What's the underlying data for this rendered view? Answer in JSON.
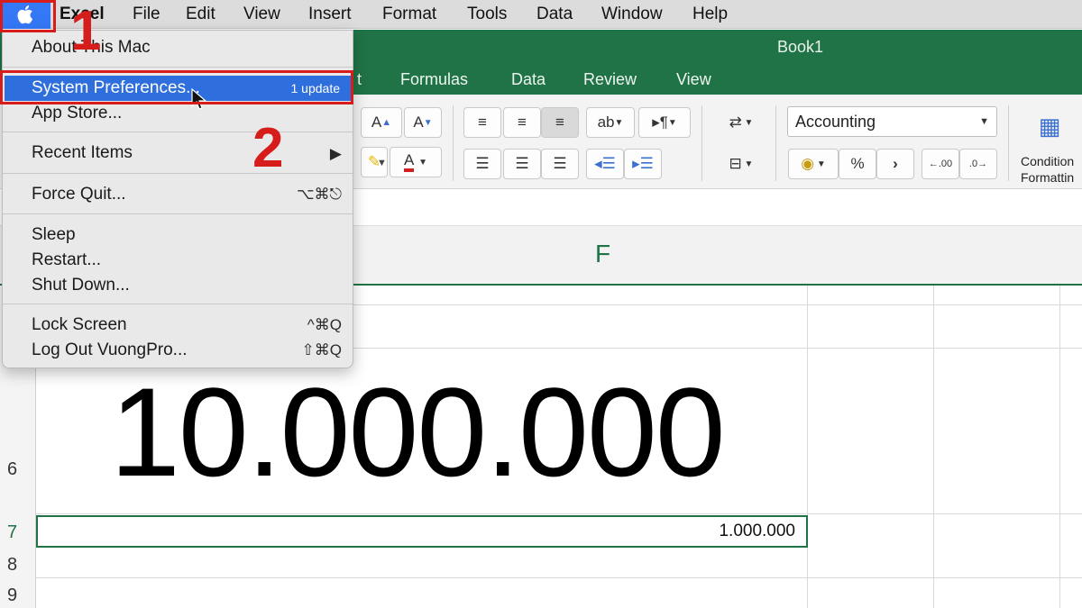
{
  "menubar": {
    "app_name": "Excel",
    "items": [
      "File",
      "Edit",
      "View",
      "Insert",
      "Format",
      "Tools",
      "Data",
      "Window",
      "Help"
    ]
  },
  "window": {
    "title": "Book1"
  },
  "ribbon": {
    "tabs": [
      "t",
      "Formulas",
      "Data",
      "Review",
      "View"
    ],
    "number_format": "Accounting",
    "conditional_formatting_label": [
      "Condition",
      "Formattin"
    ]
  },
  "apple_menu": {
    "items": {
      "about": "About This Mac",
      "system_preferences": "System Preferences...",
      "system_preferences_badge": "1 update",
      "app_store": "App Store...",
      "recent_items": "Recent Items",
      "recent_items_arrow": "▶",
      "force_quit": "Force Quit...",
      "force_quit_shortcut": "⌥⌘⎋",
      "sleep": "Sleep",
      "restart": "Restart...",
      "shut_down": "Shut Down...",
      "lock_screen": "Lock Screen",
      "lock_screen_shortcut": "^⌘Q",
      "log_out": "Log Out VuongPro...",
      "log_out_shortcut": "⇧⌘Q"
    }
  },
  "sheet": {
    "column_label": "F",
    "rows": [
      "6",
      "7",
      "8",
      "9"
    ],
    "big_number": "10.000.000",
    "cell_value": "1.000.000"
  },
  "annotations": {
    "step1": "1",
    "step2": "2"
  },
  "colors": {
    "excel_green": "#207346",
    "highlight_blue": "#2f6fdd",
    "annotation_red": "#d71c1c"
  }
}
